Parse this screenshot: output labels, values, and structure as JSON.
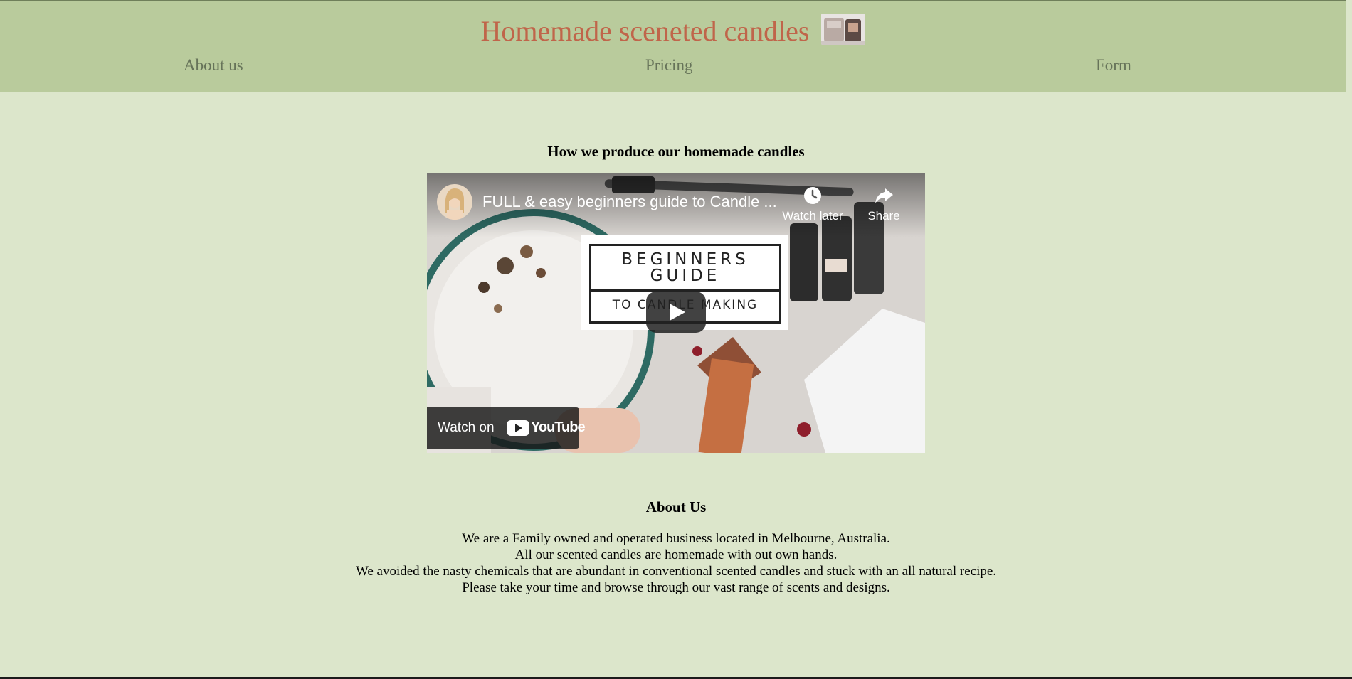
{
  "header": {
    "title": "Homemade sceneted candles",
    "logo_icon": "candle-jar-thumbnail",
    "nav": [
      {
        "label": "About us"
      },
      {
        "label": "Pricing"
      },
      {
        "label": "Form"
      }
    ],
    "background": "#b9cb9c",
    "title_color": "#c0654a"
  },
  "video_section": {
    "heading": "How we produce our homemade candles",
    "video": {
      "title": "FULL & easy beginners guide to Candle ...",
      "watch_later": "Watch later",
      "share": "Share",
      "thumbnail_line1": "BEGINNERS",
      "thumbnail_line2": "GUIDE",
      "thumbnail_line3": "TO CANDLE MAKING",
      "watch_on": "Watch on",
      "youtube": "YouTube"
    }
  },
  "about": {
    "heading": "About Us",
    "lines": [
      "We are a Family owned and operated business located in Melbourne, Australia.",
      "All our scented candles are homemade with out own hands.",
      "We avoided the nasty chemicals that are abundant in conventional scented candles and stuck with an all natural recipe.",
      "Please take your time and browse through our vast range of scents and designs."
    ]
  },
  "colors": {
    "page_background": "#dce6cb",
    "nav_text": "#667359"
  }
}
